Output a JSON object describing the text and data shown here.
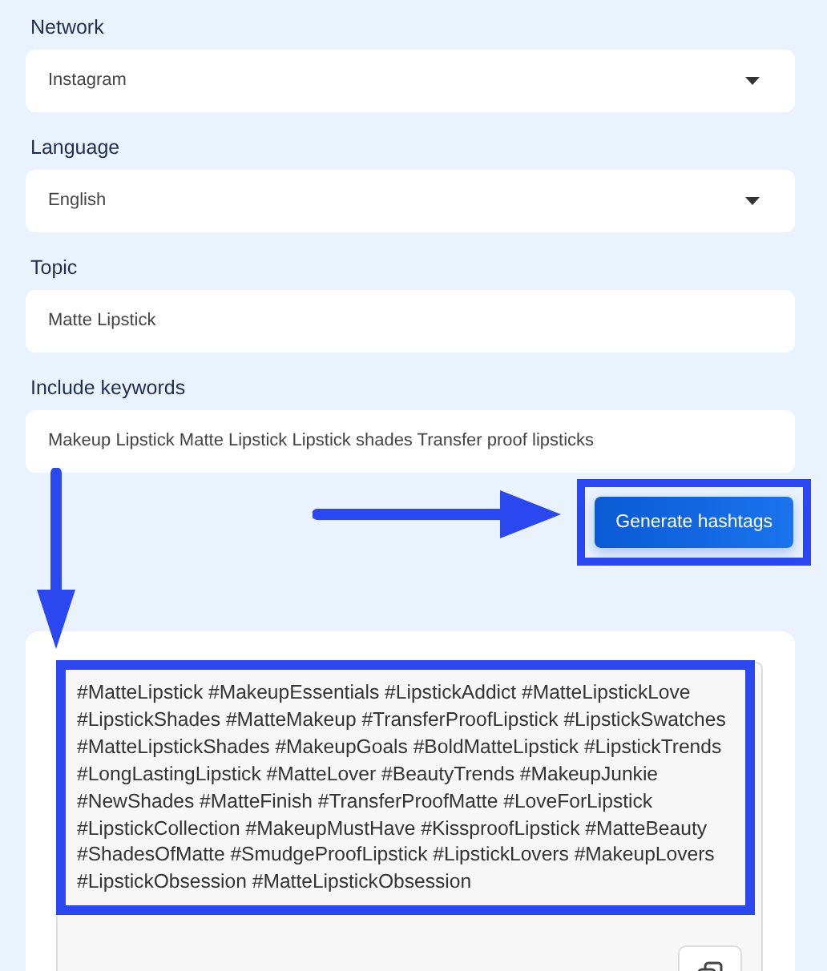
{
  "fields": [
    {
      "label": "Network",
      "kind": "select",
      "value": "Instagram"
    },
    {
      "label": "Language",
      "kind": "select",
      "value": "English"
    },
    {
      "label": "Topic",
      "kind": "text",
      "value": "Matte Lipstick"
    },
    {
      "label": "Include keywords",
      "kind": "text",
      "value": "Makeup Lipstick Matte Lipstick Lipstick shades Transfer proof lipsticks"
    }
  ],
  "generate_button": "Generate hashtags",
  "result": {
    "text": "#MatteLipstick #MakeupEssentials #LipstickAddict #MatteLipstickLove #LipstickShades #MatteMakeup #TransferProofLipstick #LipstickSwatches #MatteLipstickShades #MakeupGoals #BoldMatteLipstick #LipstickTrends #LongLastingLipstick #MatteLover #BeautyTrends #MakeupJunkie #NewShades #MatteFinish #TransferProofMatte #LoveForLipstick #LipstickCollection #MakeupMustHave #KissproofLipstick #MatteBeauty #ShadesOfMatte #SmudgeProofLipstick #LipstickLovers #MakeupLovers #LipstickObsession #MatteLipstickObsession"
  }
}
